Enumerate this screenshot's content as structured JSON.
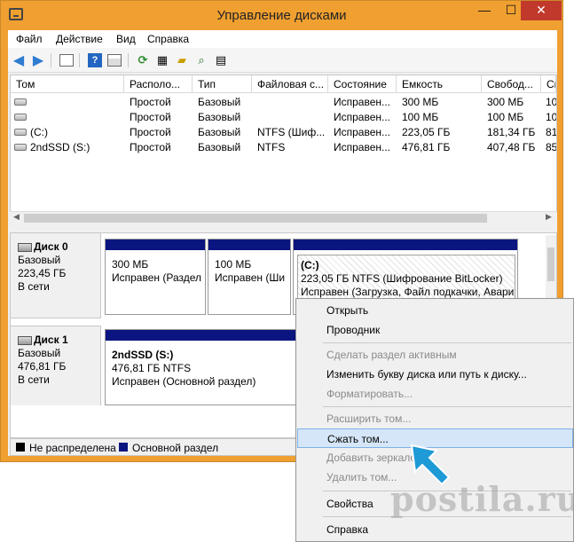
{
  "window": {
    "title": "Управление дисками",
    "min": "—",
    "max": "☐",
    "close": "✕",
    "frame_color": "#f0a030"
  },
  "menu": {
    "items": [
      "Файл",
      "Действие",
      "Вид",
      "Справка"
    ]
  },
  "toolbar": {
    "icons": [
      "back-arrow-icon",
      "forward-arrow-icon",
      "properties-icon",
      "help-icon",
      "console-icon",
      "refresh-icon",
      "rescan-icon",
      "open-icon",
      "search-icon",
      "settings-icon"
    ]
  },
  "volumes": {
    "columns": [
      "Том",
      "Располо...",
      "Тип",
      "Файловая с...",
      "Состояние",
      "Емкость",
      "Свобод...",
      "Сво"
    ],
    "rows": [
      {
        "tom": "",
        "layout": "Простой",
        "type": "Базовый",
        "fs": "",
        "status": "Исправен...",
        "capacity": "300 МБ",
        "free": "300 МБ",
        "pct": "100"
      },
      {
        "tom": "",
        "layout": "Простой",
        "type": "Базовый",
        "fs": "",
        "status": "Исправен...",
        "capacity": "100 МБ",
        "free": "100 МБ",
        "pct": "100"
      },
      {
        "tom": "(C:)",
        "layout": "Простой",
        "type": "Базовый",
        "fs": "NTFS (Шиф...",
        "status": "Исправен...",
        "capacity": "223,05 ГБ",
        "free": "181,34 ГБ",
        "pct": "81"
      },
      {
        "tom": "2ndSSD (S:)",
        "layout": "Простой",
        "type": "Базовый",
        "fs": "NTFS",
        "status": "Исправен...",
        "capacity": "476,81 ГБ",
        "free": "407,48 ГБ",
        "pct": "85"
      }
    ]
  },
  "disks": [
    {
      "name": "Диск 0",
      "type": "Базовый",
      "size": "223,45 ГБ",
      "state": "В сети",
      "partitions": [
        {
          "l1": "300 МБ",
          "l2": "Исправен (Раздел"
        },
        {
          "l1": "100 МБ",
          "l2": "Исправен (Ши"
        },
        {
          "title": "(C:)",
          "l1": "223,05 ГБ NTFS (Шифрование BitLocker)",
          "l2": "Исправен (Загрузка, Файл подкачки, Авари"
        }
      ]
    },
    {
      "name": "Диск 1",
      "type": "Базовый",
      "size": "476,81 ГБ",
      "state": "В сети",
      "partitions": [
        {
          "title": "2ndSSD  (S:)",
          "l1": "476,81 ГБ NTFS",
          "l2": "Исправен (Основной раздел)"
        }
      ]
    }
  ],
  "legend": {
    "unallocated": "Не распределена",
    "primary": "Основной раздел",
    "unallocated_color": "#000000",
    "primary_color": "#0b1580"
  },
  "context_menu": {
    "items": [
      {
        "label": "Открыть",
        "disabled": false
      },
      {
        "label": "Проводник",
        "disabled": false
      },
      {
        "label": "Сделать раздел активным",
        "disabled": true
      },
      {
        "label": "Изменить букву диска или путь к диску...",
        "disabled": false
      },
      {
        "label": "Форматировать...",
        "disabled": true
      },
      {
        "label": "Расширить том...",
        "disabled": true
      },
      {
        "label": "Сжать том...",
        "disabled": false,
        "highlighted": true
      },
      {
        "label": "Добавить зеркало...",
        "disabled": true
      },
      {
        "label": "Удалить том...",
        "disabled": true
      },
      {
        "label": "Свойства",
        "disabled": false
      },
      {
        "label": "Справка",
        "disabled": false
      }
    ]
  },
  "watermark": "postila.ru"
}
